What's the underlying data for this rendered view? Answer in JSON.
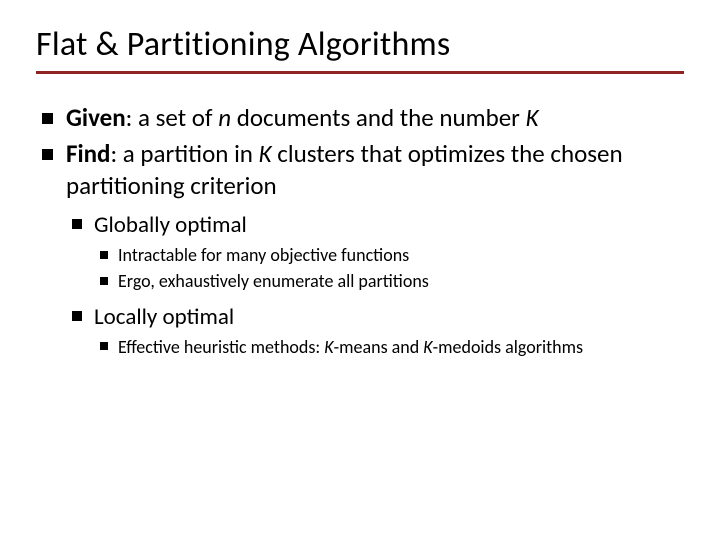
{
  "title": "Flat & Partitioning Algorithms",
  "given_label": "Given",
  "given_rest_a": ": a set of ",
  "given_n": "n",
  "given_rest_b": " documents and the number ",
  "given_K": "K",
  "find_label": "Find",
  "find_rest_a": ": a partition in ",
  "find_K": "K",
  "find_rest_b": " clusters that optimizes the chosen partitioning criterion",
  "global_label": "Globally optimal",
  "global_sub1": "Intractable for many objective functions",
  "global_sub2": "Ergo, exhaustively enumerate all partitions",
  "local_label": "Locally optimal",
  "local_sub1_a": "Effective heuristic methods: ",
  "local_sub1_k1": "K",
  "local_sub1_b": "-means and ",
  "local_sub1_k2": "K",
  "local_sub1_c": "-medoids algorithms"
}
